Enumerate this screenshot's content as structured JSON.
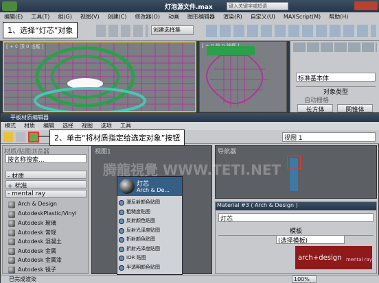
{
  "app": {
    "title": "灯泡源文件.max",
    "search_placeholder": "键入关键字或短语",
    "menu": [
      "编辑(E)",
      "工具(T)",
      "组(G)",
      "视图(V)",
      "创建(C)",
      "修改器(O)",
      "动画",
      "图形编辑器",
      "渲染(R)",
      "自定义(U)",
      "MAXScript(M)",
      "帮助(H)"
    ],
    "selection_set": "创建选择集",
    "viewport_left_label": "[ + 0 顶 0 线框 ]",
    "viewport_right_label": "[ + 0 前 0 线框 ]",
    "right_panel": {
      "dropdown": "标准基本体",
      "rollout": "对象类型",
      "auto_grid": "自动栅格",
      "btn1": "长方体",
      "btn2": "圆锥体"
    }
  },
  "mat_editor": {
    "title": "平板材质编辑器",
    "menu": [
      "模式",
      "材质",
      "编辑",
      "选择",
      "视图",
      "选项",
      "工具"
    ],
    "view_dropdown": "视图 1",
    "browser_title": "材质/贴图浏览器",
    "search": "按名称搜索...",
    "sections": [
      "- 材质",
      "+ 标准",
      "- mental ray"
    ],
    "materials": [
      "Arch & Design",
      "AutodeskPlastic/Vinyl",
      "Autodesk 玻璃",
      "Autodesk 常规",
      "Autodesk 混凝土",
      "Autodesk 金属",
      "Autodesk 金属漆",
      "Autodesk 镜子"
    ],
    "node_title": "灯芯",
    "node_subtitle": "Arch & De...",
    "slots": [
      "漫反射颜色贴图",
      "粗糙度贴图",
      "反射颜色贴图",
      "反射光泽度贴图",
      "折射颜色贴图",
      "折射光泽度贴图",
      "IOR 贴图",
      "半透明颜色贴图"
    ],
    "view_tab": "视图1",
    "navigator_title": "导航器",
    "material_header": "Material #3 ( Arch & Design )",
    "material_name": "灯芯",
    "template_rollout": "模板",
    "template_select": "(选择模板)",
    "brand": "arch+design",
    "brand_sub": "mental ray",
    "status": "已完成渲染",
    "zoom": "100%"
  },
  "callouts": {
    "step1": "1、选择“灯芯”对象",
    "step2": "2、单击“将材质指定给选定对象”按钮"
  },
  "watermark": "腾龍視覺 WWW.TETI.NET",
  "colors": {
    "select_box": "#e8362c",
    "wire_green": "#2aa04a",
    "wire_magenta": "#b0339c"
  }
}
